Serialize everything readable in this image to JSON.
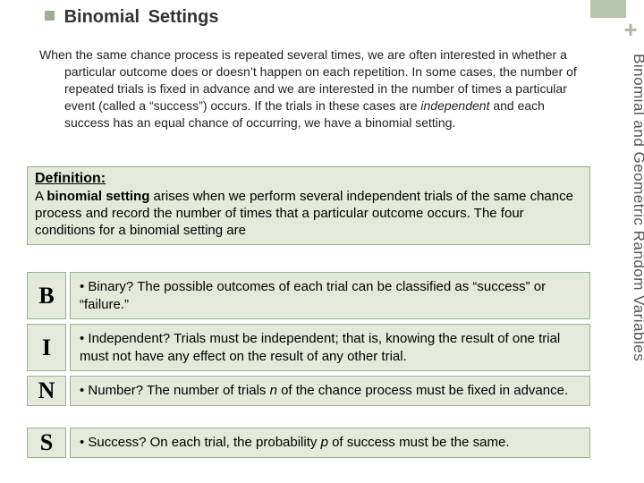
{
  "header": {
    "title_strong": "Binomial",
    "title_rest": "Settings"
  },
  "corner_plus": "+",
  "side_label": "Binomial and Geometric Random Variables",
  "intro": {
    "text_part1": "When the same chance process is repeated several times, we are often interested in whether a particular outcome does or doesn’t happen on each repetition. In some cases, the number of repeated trials is fixed in advance and we are interested in the number of times a particular event (called a “success”) occurs. If the trials in these cases are ",
    "text_italic": "independent",
    "text_part2": " and each success has an equal chance of occurring, we have a binomial setting."
  },
  "definition": {
    "heading": "Definition:",
    "body_pre": "A ",
    "body_bold": "binomial setting",
    "body_post": " arises when we perform several independent trials of the same chance process and record the number of times that a particular outcome occurs. The four conditions for a binomial setting are"
  },
  "conditions": [
    {
      "letter": "B",
      "prefix": "• Binary? ",
      "body": "The possible outcomes of each trial can be classified as “success” or “failure.”"
    },
    {
      "letter": "I",
      "prefix": "• Independent? ",
      "body": "Trials must be independent; that is, knowing the result of one trial must not have any effect on the result of any other trial."
    },
    {
      "letter": "N",
      "prefix": "• Number? ",
      "body_pre": "The number of trials ",
      "body_italic": "n",
      "body_post": " of the chance process must be fixed in advance."
    },
    {
      "letter": "S",
      "prefix": "• Success? ",
      "body_pre": "On each trial, the probability ",
      "body_italic": "p",
      "body_post": " of success must be the same."
    }
  ]
}
